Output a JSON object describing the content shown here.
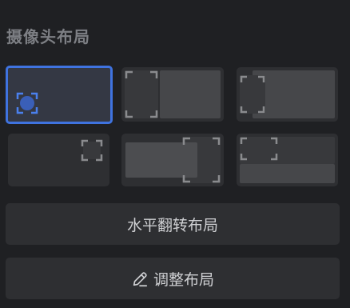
{
  "section": {
    "title": "摄像头布局"
  },
  "layouts": {
    "selected_index": 0,
    "options": [
      {
        "name": "camera-bottom-left-corner"
      },
      {
        "name": "camera-left-split"
      },
      {
        "name": "camera-top-left-overlap"
      },
      {
        "name": "camera-top-right-corner"
      },
      {
        "name": "camera-right-overlap"
      },
      {
        "name": "camera-top-left-banner"
      }
    ]
  },
  "buttons": {
    "flip_label": "水平翻转布局",
    "adjust_label": "调整布局",
    "adjust_icon": "pencil-icon"
  },
  "colors": {
    "accent": "#3f73e0",
    "background": "#1f2023",
    "tile": "#2e2f32"
  }
}
